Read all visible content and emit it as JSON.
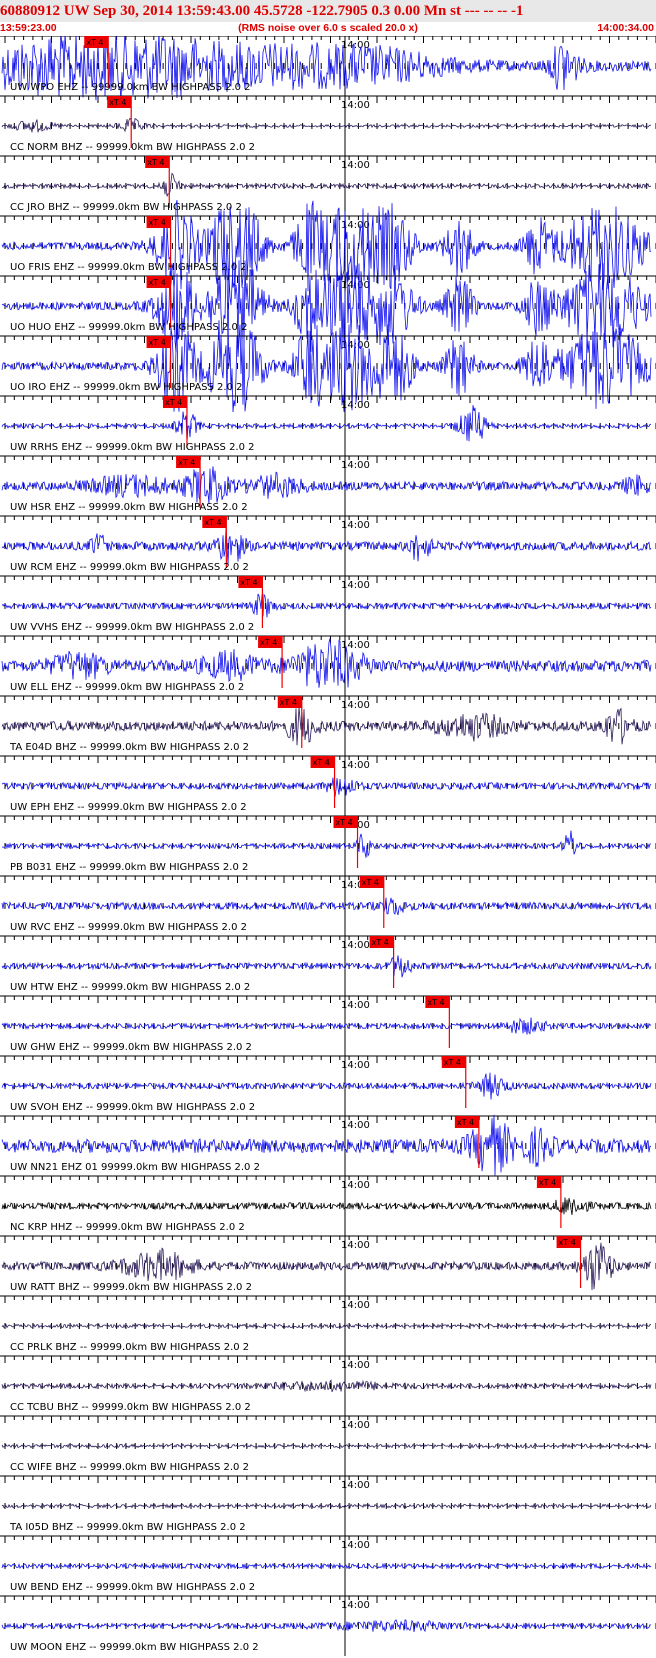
{
  "header": {
    "title": "60880912 UW Sep 30, 2014 13:59:43.00   45.5728 -122.7905  0.3 0.00 Mn st --- -- --  -1",
    "start_time": "13:59:23.00",
    "noise_note": "(RMS noise over 6.0 s scaled 20.0 x)",
    "end_time": "14:00:34.00"
  },
  "chart_data": {
    "type": "seismogram",
    "time_range": [
      "13:59:23.00",
      "14:00:34.00"
    ],
    "time_marker_label": "14:00",
    "pick_label": "xT 4",
    "colors": {
      "blue": "#1010ee",
      "dark": "#2a1a5a",
      "black": "#000000",
      "pick": "#ee0000"
    },
    "traces": [
      {
        "label": "UW WPO EHZ -- 99999.0km BW  HIGHPASS  2.0  2",
        "color": "blue",
        "pick": 0.165,
        "amp": 0.75,
        "noise": 0.22,
        "bursts": [
          [
            0.02,
            0.3,
            0.45
          ],
          [
            0.16,
            0.12,
            0.7
          ],
          [
            0.23,
            0.2,
            0.55
          ],
          [
            0.44,
            0.12,
            0.45
          ],
          [
            0.58,
            0.1,
            0.5
          ],
          [
            0.86,
            0.02,
            1.0
          ]
        ]
      },
      {
        "label": "CC NORM BHZ -- 99999.0km BW  HIGHPASS  2.0  2",
        "color": "dark",
        "pick": 0.2,
        "amp": 0.5,
        "noise": 0.08,
        "bursts": [
          [
            0.05,
            0.03,
            0.35
          ],
          [
            0.2,
            0.02,
            0.4
          ]
        ]
      },
      {
        "label": "CC JRO BHZ -- 99999.0km BW  HIGHPASS  2.0  2",
        "color": "dark",
        "pick": 0.258,
        "amp": 0.5,
        "noise": 0.12,
        "bursts": [
          [
            0.258,
            0.015,
            0.7
          ]
        ]
      },
      {
        "label": "UO FRIS EHZ -- 99999.0km BW  HIGHPASS  2.0  2",
        "color": "blue",
        "pick": 0.26,
        "amp": 1.0,
        "noise": 0.12,
        "bursts": [
          [
            0.27,
            0.03,
            1.3
          ],
          [
            0.34,
            0.02,
            1.3
          ],
          [
            0.37,
            0.03,
            1.3
          ],
          [
            0.47,
            0.02,
            1.0
          ],
          [
            0.53,
            0.05,
            1.3
          ],
          [
            0.6,
            0.03,
            1.0
          ],
          [
            0.7,
            0.02,
            0.9
          ],
          [
            0.82,
            0.02,
            0.8
          ],
          [
            0.92,
            0.06,
            1.3
          ]
        ]
      },
      {
        "label": "UO HUO EHZ -- 99999.0km BW  HIGHPASS  2.0  2",
        "color": "blue",
        "pick": 0.26,
        "amp": 1.0,
        "noise": 0.12,
        "bursts": [
          [
            0.27,
            0.03,
            1.3
          ],
          [
            0.34,
            0.02,
            1.3
          ],
          [
            0.37,
            0.03,
            1.3
          ],
          [
            0.47,
            0.02,
            1.0
          ],
          [
            0.53,
            0.05,
            1.3
          ],
          [
            0.6,
            0.03,
            1.0
          ],
          [
            0.7,
            0.02,
            0.9
          ],
          [
            0.82,
            0.02,
            0.8
          ],
          [
            0.92,
            0.06,
            1.3
          ]
        ]
      },
      {
        "label": "UO IRO EHZ -- 99999.0km BW  HIGHPASS  2.0  2",
        "color": "blue",
        "pick": 0.26,
        "amp": 1.0,
        "noise": 0.12,
        "bursts": [
          [
            0.27,
            0.03,
            1.3
          ],
          [
            0.34,
            0.02,
            1.3
          ],
          [
            0.37,
            0.03,
            1.3
          ],
          [
            0.47,
            0.02,
            1.0
          ],
          [
            0.53,
            0.05,
            1.3
          ],
          [
            0.6,
            0.03,
            1.0
          ],
          [
            0.7,
            0.02,
            0.9
          ],
          [
            0.82,
            0.02,
            0.8
          ],
          [
            0.92,
            0.06,
            1.3
          ]
        ]
      },
      {
        "label": "UW RRHS EHZ -- 99999.0km BW  HIGHPASS  2.0  2",
        "color": "blue",
        "pick": 0.285,
        "amp": 0.6,
        "noise": 0.1,
        "bursts": [
          [
            0.285,
            0.015,
            0.8
          ],
          [
            0.72,
            0.02,
            1.0
          ]
        ]
      },
      {
        "label": "UW HSR EHZ -- 99999.0km BW  HIGHPASS  2.0  2",
        "color": "blue",
        "pick": 0.305,
        "amp": 0.6,
        "noise": 0.22,
        "bursts": [
          [
            0.2,
            0.06,
            0.45
          ],
          [
            0.315,
            0.03,
            0.9
          ],
          [
            0.42,
            0.04,
            0.5
          ],
          [
            0.97,
            0.02,
            0.4
          ]
        ]
      },
      {
        "label": "UW RCM EHZ -- 99999.0km BW  HIGHPASS  2.0  2",
        "color": "blue",
        "pick": 0.345,
        "amp": 0.6,
        "noise": 0.22,
        "bursts": [
          [
            0.15,
            0.01,
            0.6
          ],
          [
            0.35,
            0.02,
            0.9
          ],
          [
            0.64,
            0.015,
            0.7
          ]
        ]
      },
      {
        "label": "UW VVHS EHZ -- 99999.0km BW  HIGHPASS  2.0  2",
        "color": "blue",
        "pick": 0.4,
        "amp": 0.5,
        "noise": 0.18,
        "bursts": [
          [
            0.4,
            0.015,
            0.7
          ]
        ]
      },
      {
        "label": "UW ELL EHZ -- 99999.0km BW  HIGHPASS  2.0  2",
        "color": "blue",
        "pick": 0.43,
        "amp": 0.7,
        "noise": 0.25,
        "bursts": [
          [
            0.12,
            0.04,
            0.5
          ],
          [
            0.5,
            0.05,
            1.0
          ],
          [
            0.35,
            0.04,
            0.5
          ]
        ]
      },
      {
        "label": "TA E04D BHZ -- 99999.0km BW  HIGHPASS  2.0  2",
        "color": "dark",
        "pick": 0.46,
        "amp": 0.6,
        "noise": 0.25,
        "bursts": [
          [
            0.46,
            0.02,
            0.9
          ],
          [
            0.72,
            0.05,
            0.55
          ],
          [
            0.94,
            0.02,
            0.8
          ]
        ]
      },
      {
        "label": "UW EPH EHZ -- 99999.0km BW  HIGHPASS  2.0  2",
        "color": "blue",
        "pick": 0.51,
        "amp": 0.5,
        "noise": 0.2,
        "bursts": [
          [
            0.52,
            0.02,
            0.6
          ]
        ]
      },
      {
        "label": "PB B031 EHZ -- 99999.0km BW  HIGHPASS  2.0  2",
        "color": "blue",
        "pick": 0.545,
        "amp": 0.5,
        "noise": 0.15,
        "bursts": [
          [
            0.555,
            0.01,
            0.8
          ],
          [
            0.87,
            0.01,
            0.9
          ]
        ]
      },
      {
        "label": "UW RVC EHZ -- 99999.0km BW  HIGHPASS  2.0  2",
        "color": "blue",
        "pick": 0.585,
        "amp": 0.5,
        "noise": 0.22,
        "bursts": [
          [
            0.6,
            0.02,
            0.45
          ]
        ]
      },
      {
        "label": "UW HTW EHZ -- 99999.0km BW  HIGHPASS  2.0  2",
        "color": "blue",
        "pick": 0.6,
        "amp": 0.5,
        "noise": 0.18,
        "bursts": [
          [
            0.61,
            0.015,
            0.7
          ]
        ]
      },
      {
        "label": "UW GHW EHZ -- 99999.0km BW  HIGHPASS  2.0  2",
        "color": "blue",
        "pick": 0.685,
        "amp": 0.5,
        "noise": 0.16,
        "bursts": [
          [
            0.8,
            0.03,
            0.4
          ]
        ]
      },
      {
        "label": "UW SVOH EHZ -- 99999.0km BW  HIGHPASS  2.0  2",
        "color": "blue",
        "pick": 0.71,
        "amp": 0.5,
        "noise": 0.18,
        "bursts": [
          [
            0.75,
            0.02,
            0.7
          ]
        ]
      },
      {
        "label": "UW NN21 EHZ 01 99999.0km BW  HIGHPASS  2.0  2",
        "color": "blue",
        "pick": 0.73,
        "amp": 0.75,
        "noise": 0.28,
        "bursts": [
          [
            0.75,
            0.03,
            1.0
          ],
          [
            0.82,
            0.02,
            0.6
          ]
        ]
      },
      {
        "label": "NC KRP HHZ -- 99999.0km BW  HIGHPASS  2.0  2",
        "color": "black",
        "pick": 0.855,
        "amp": 0.5,
        "noise": 0.2,
        "bursts": [
          [
            0.87,
            0.02,
            0.6
          ]
        ]
      },
      {
        "label": "UW RATT BHZ -- 99999.0km BW  HIGHPASS  2.0  2",
        "color": "dark",
        "pick": 0.885,
        "amp": 0.7,
        "noise": 0.18,
        "bursts": [
          [
            0.24,
            0.05,
            0.6
          ],
          [
            0.91,
            0.02,
            1.1
          ]
        ]
      },
      {
        "label": "CC PRLK BHZ -- 99999.0km BW  HIGHPASS  2.0  2",
        "color": "dark",
        "pick": null,
        "amp": 0.4,
        "noise": 0.12,
        "bursts": []
      },
      {
        "label": "CC TCBU BHZ -- 99999.0km BW  HIGHPASS  2.0  2",
        "color": "dark",
        "pick": null,
        "amp": 0.4,
        "noise": 0.16,
        "bursts": [
          [
            0.5,
            0.1,
            0.3
          ]
        ]
      },
      {
        "label": "CC WIFE BHZ -- 99999.0km BW  HIGHPASS  2.0  2",
        "color": "dark",
        "pick": null,
        "amp": 0.4,
        "noise": 0.12,
        "bursts": []
      },
      {
        "label": "TA I05D BHZ -- 99999.0km BW  HIGHPASS  2.0  2",
        "color": "dark",
        "pick": null,
        "amp": 0.4,
        "noise": 0.12,
        "bursts": []
      },
      {
        "label": "UW BEND EHZ -- 99999.0km BW  HIGHPASS  2.0  2",
        "color": "blue",
        "pick": null,
        "amp": 0.4,
        "noise": 0.16,
        "bursts": []
      },
      {
        "label": "UW MOON EHZ -- 99999.0km BW  HIGHPASS  2.0  2",
        "color": "blue",
        "pick": null,
        "amp": 0.4,
        "noise": 0.18,
        "bursts": [
          [
            0.6,
            0.1,
            0.3
          ]
        ]
      }
    ]
  }
}
